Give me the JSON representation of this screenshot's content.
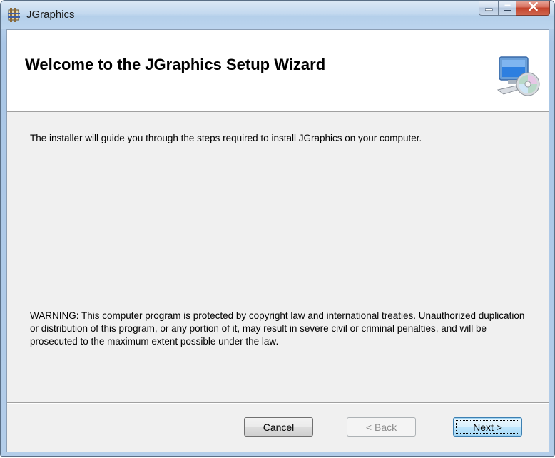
{
  "window": {
    "title": "JGraphics",
    "minimize_icon": "minimize-icon",
    "maximize_icon": "maximize-icon",
    "close_icon": "close-icon"
  },
  "banner": {
    "title": "Welcome to the JGraphics Setup Wizard",
    "icon": "computer-cd-icon"
  },
  "body": {
    "intro": "The installer will guide you through the steps required to install JGraphics on your computer.",
    "warning": "WARNING: This computer program is protected by copyright law and international treaties. Unauthorized duplication or distribution of this program, or any portion of it, may result in severe civil or criminal penalties, and will be prosecuted to the maximum extent possible under the law."
  },
  "buttons": {
    "cancel": "Cancel",
    "back_prefix": "< ",
    "back_mnemonic": "B",
    "back_rest": "ack",
    "next_mnemonic": "N",
    "next_rest": "ext >"
  }
}
